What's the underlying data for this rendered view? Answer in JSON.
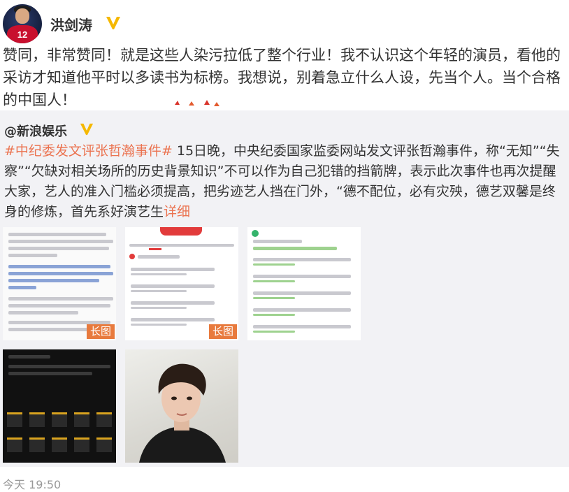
{
  "post": {
    "username": "洪剑涛",
    "verified_icon": "yellow-v-badge",
    "text": "赞同，非常赞同！就是这些人染污拉低了整个行业！我不认识这个年轻的演员，看他的采访才知道他平时以多读书为标榜。我想说，别着急立什么人设，先当个人。当个合格的中国人！",
    "jersey_number": "12"
  },
  "repost": {
    "username": "@新浪娱乐",
    "hashtag": "#中纪委发文评张哲瀚事件#",
    "body": " 15日晚，中央纪委国家监委网站发文评张哲瀚事件，称“无知”“失察”“欠缺对相关场所的历史背景知识”不可以作为自己犯错的挡箭牌，表示此次事件也再次提醒大家，艺人的准入门槛必须提高，把劣迹艺人挡在门外，“德不配位，必有灾殃，德艺双馨是终身的修炼，首先系好演艺生",
    "more_link": "详细",
    "images": [
      {
        "tag": "长图"
      },
      {
        "tag": "长图"
      },
      {
        "tag": ""
      },
      {
        "tag": ""
      },
      {
        "tag": ""
      }
    ]
  },
  "timestamp": "今天 19:50",
  "colors": {
    "link": "#eb7350",
    "badge": "#f5b800",
    "repost_bg": "#f2f2f5"
  }
}
